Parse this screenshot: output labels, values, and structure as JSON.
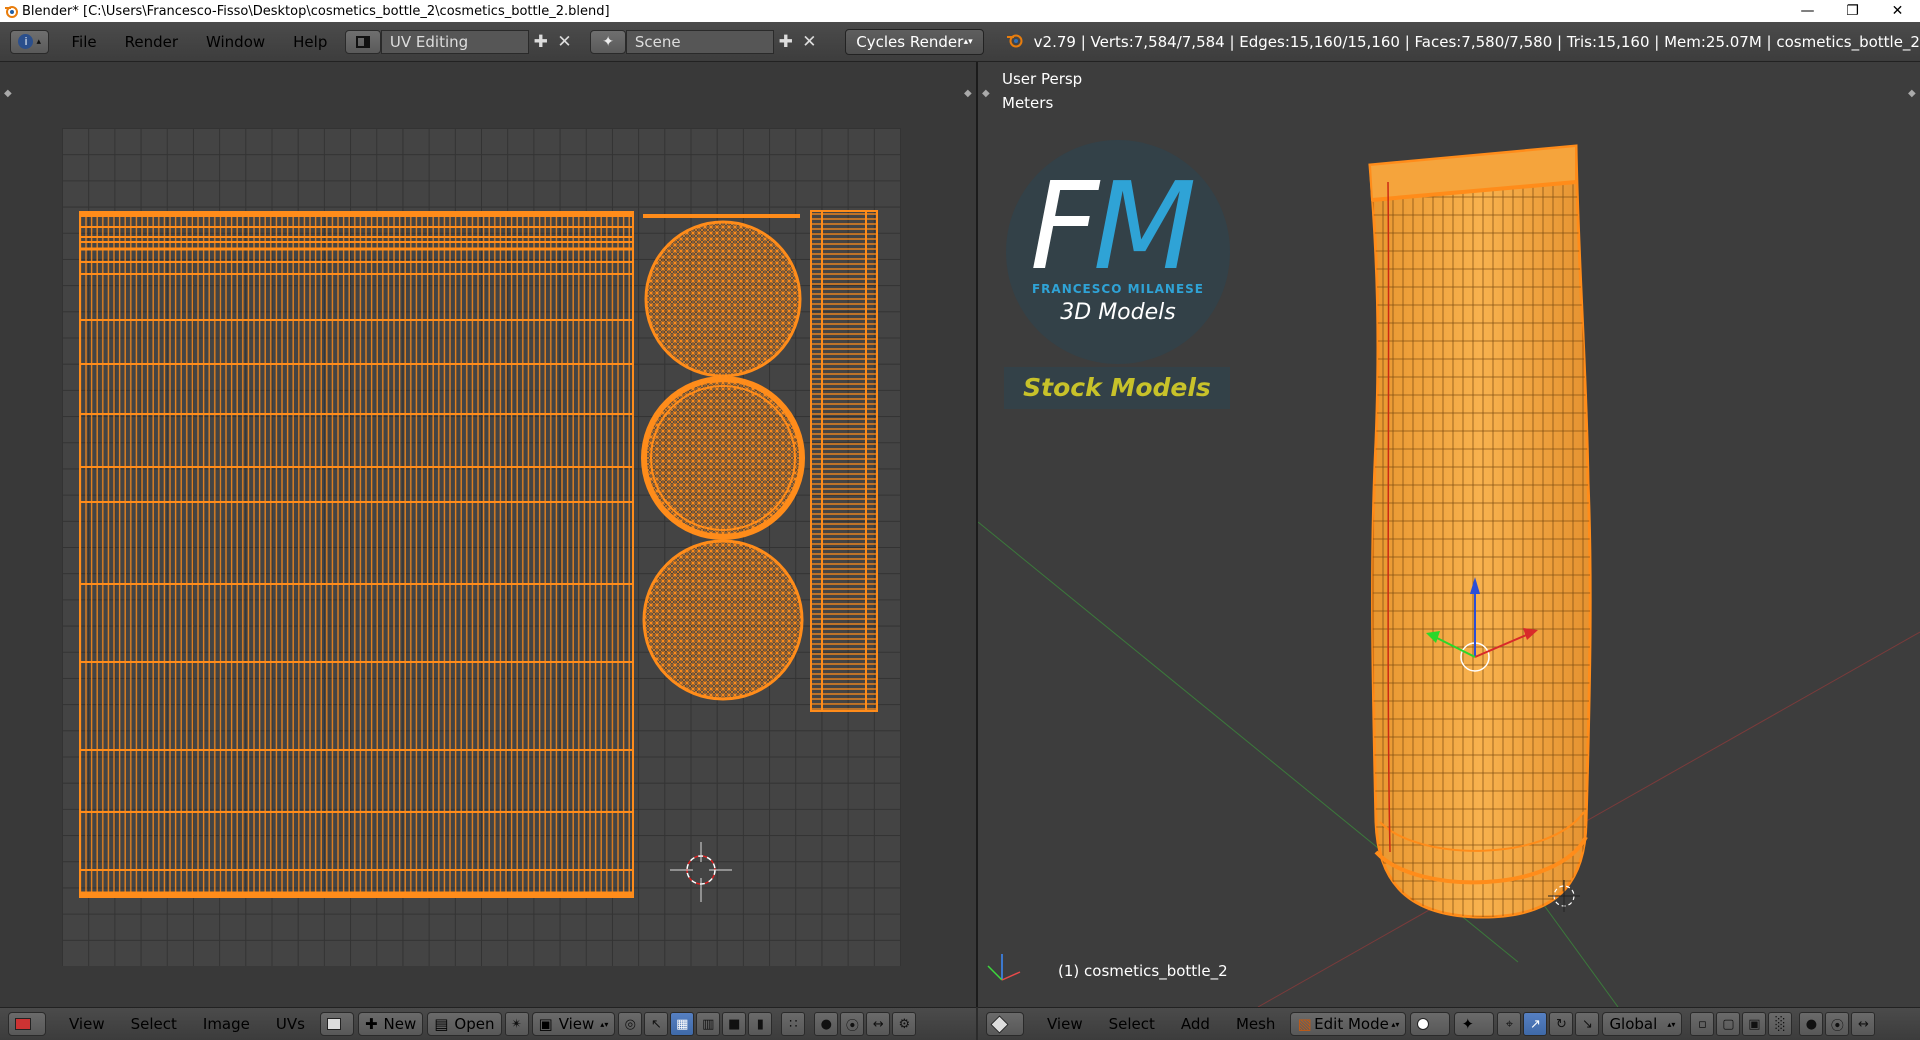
{
  "window": {
    "title": "Blender* [C:\\Users\\Francesco-Fisso\\Desktop\\cosmetics_bottle_2\\cosmetics_bottle_2.blend]",
    "minimize": "—",
    "maximize": "❐",
    "close": "✕"
  },
  "topbar": {
    "menus": [
      "File",
      "Render",
      "Window",
      "Help"
    ],
    "screen_layout": "UV Editing",
    "scene": "Scene",
    "render_engine": "Cycles Render",
    "stats": "v2.79 | Verts:7,584/7,584 | Edges:15,160/15,160 | Faces:7,580/7,580 | Tris:15,160 | Mem:25.07M | cosmetics_bottle_2"
  },
  "uv_editor": {
    "menus": [
      "View",
      "Select",
      "Image",
      "UVs"
    ],
    "new_label": "New",
    "open_label": "Open",
    "view_label": "View"
  },
  "viewport": {
    "view_name": "User Persp",
    "units": "Meters",
    "object_label": "(1) cosmetics_bottle_2",
    "menus": [
      "View",
      "Select",
      "Add",
      "Mesh"
    ],
    "mode": "Edit Mode",
    "orientation": "Global"
  },
  "watermark": {
    "brand_f": "F",
    "brand_m": "M",
    "name": "FRANCESCO MILANESE",
    "tagline": "3D Models",
    "stock": "Stock Models"
  },
  "colors": {
    "mesh": "#ff8c1a",
    "accent": "#2fa3d6",
    "stock_text": "#c8c22a"
  }
}
